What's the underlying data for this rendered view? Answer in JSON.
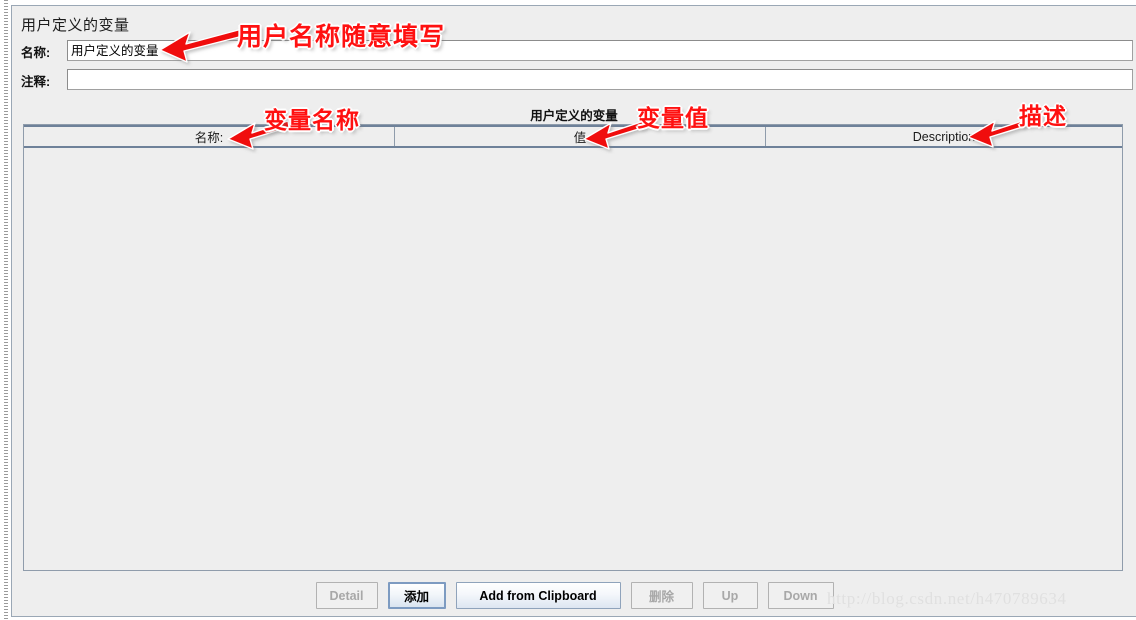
{
  "panel": {
    "title": "用户定义的变量",
    "fields": [
      {
        "label": "名称:",
        "value": "用户定义的变量"
      },
      {
        "label": "注释:",
        "value": ""
      }
    ]
  },
  "table": {
    "caption": "用户定义的变量",
    "columns": [
      "名称:",
      "值",
      "Description"
    ],
    "rows": []
  },
  "buttons": [
    {
      "label": "Detail",
      "state": "disabled"
    },
    {
      "label": "添加",
      "state": "focused"
    },
    {
      "label": "Add from Clipboard",
      "state": "enabled"
    },
    {
      "label": "删除",
      "state": "disabled"
    },
    {
      "label": "Up",
      "state": "disabled"
    },
    {
      "label": "Down",
      "state": "disabled"
    }
  ],
  "annotations": [
    {
      "text": "用户名称随意填写",
      "target": "name-field"
    },
    {
      "text": "变量名称",
      "target": "column-name"
    },
    {
      "text": "变量值",
      "target": "column-value"
    },
    {
      "text": "描述",
      "target": "column-description"
    }
  ],
  "watermark": "http://blog.csdn.net/h470789634",
  "colors": {
    "background": "#eeeeee",
    "annotation": "#ff1111",
    "header_border": "#6e8199",
    "panel_border": "#9aa7b5"
  }
}
